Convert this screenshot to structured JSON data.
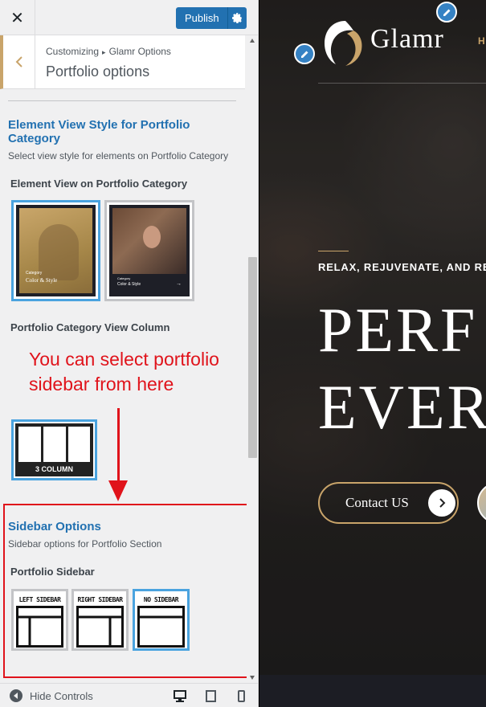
{
  "topbar": {
    "close_icon": "close-icon",
    "publish_label": "Publish",
    "gear_icon": "gear-icon"
  },
  "section": {
    "breadcrumb_root": "Customizing",
    "breadcrumb_parent": "Glamr Options",
    "title": "Portfolio options"
  },
  "element_view": {
    "title_line1": "Element View Style for Portfolio",
    "title_line2": "Category",
    "description": "Select view style for elements on Portfolio Category",
    "control_label": "Element View on Portfolio Category",
    "options": [
      {
        "kicker": "Category",
        "caption": "Color & Style",
        "selected": true
      },
      {
        "kicker": "Category",
        "caption": "Color & Style",
        "selected": false
      }
    ]
  },
  "view_column": {
    "control_label": "Portfolio Category View Column",
    "option_label": "3 COLUMN"
  },
  "annotation": {
    "text_line1": "You can select portfolio",
    "text_line2": "sidebar from here",
    "color": "#e0131b"
  },
  "sidebar_options": {
    "title": "Sidebar Options",
    "description": "Sidebar options for Portfolio Section",
    "control_label": "Portfolio Sidebar",
    "options": [
      {
        "label": "LEFT SIDEBAR",
        "selected": false
      },
      {
        "label": "RIGHT SIDEBAR",
        "selected": false
      },
      {
        "label": "NO SIDEBAR",
        "selected": true
      }
    ]
  },
  "footer": {
    "hide_controls_label": "Hide Controls",
    "device_icons": [
      "desktop-icon",
      "tablet-icon",
      "mobile-icon"
    ]
  },
  "preview": {
    "logo_text": "Glamr",
    "nav_peek": "H",
    "tagline": "RELAX, REJUVENATE, AND RE",
    "hero_line1": "PERF",
    "hero_line2": "EVER",
    "contact_label": "Contact US",
    "accent_color": "#c9a46a"
  },
  "colors": {
    "wp_blue": "#2271b1",
    "selected_border": "#4aa3df"
  }
}
